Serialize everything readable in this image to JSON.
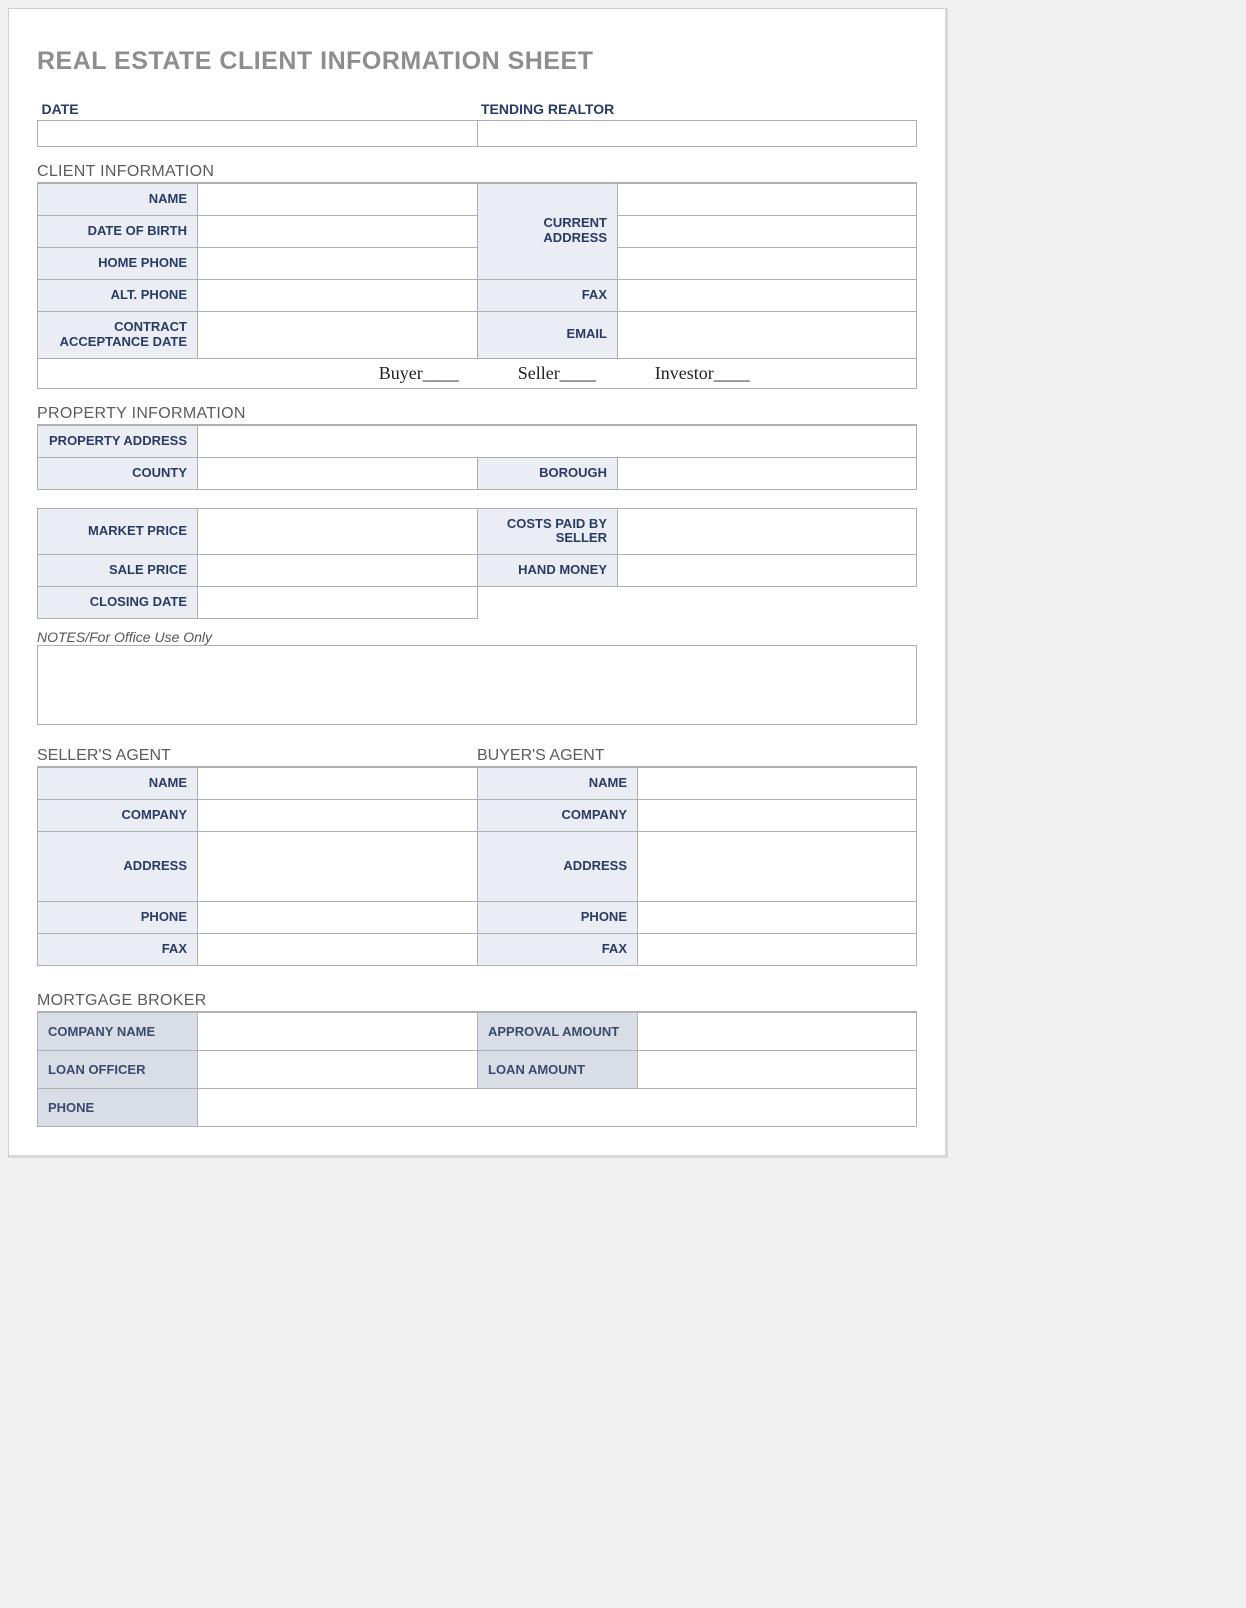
{
  "title": "REAL ESTATE CLIENT INFORMATION SHEET",
  "top": {
    "date_label": "DATE",
    "realtor_label": "TENDING REALTOR",
    "date_value": "",
    "realtor_value": ""
  },
  "client": {
    "heading": "CLIENT INFORMATION",
    "name_label": "NAME",
    "name_value": "",
    "dob_label": "DATE OF BIRTH",
    "dob_value": "",
    "home_phone_label": "HOME PHONE",
    "home_phone_value": "",
    "alt_phone_label": "ALT. PHONE",
    "alt_phone_value": "",
    "contract_date_label": "CONTRACT ACCEPTANCE DATE",
    "contract_date_value": "",
    "current_address_label": "CURRENT ADDRESS",
    "current_address_value": "",
    "fax_label": "FAX",
    "fax_value": "",
    "email_label": "EMAIL",
    "email_value": "",
    "role_buyer": "Buyer____",
    "role_seller": "Seller____",
    "role_investor": "Investor____"
  },
  "property": {
    "heading": "PROPERTY INFORMATION",
    "address_label": "PROPERTY ADDRESS",
    "address_value": "",
    "county_label": "COUNTY",
    "county_value": "",
    "borough_label": "BOROUGH",
    "borough_value": "",
    "market_price_label": "MARKET PRICE",
    "market_price_value": "",
    "costs_label": "COSTS PAID BY SELLER",
    "costs_value": "",
    "sale_price_label": "SALE PRICE",
    "sale_price_value": "",
    "hand_money_label": "HAND MONEY",
    "hand_money_value": "",
    "closing_date_label": "CLOSING DATE",
    "closing_date_value": ""
  },
  "notes": {
    "label": "NOTES/For Office Use Only",
    "value": ""
  },
  "seller_agent": {
    "heading": "SELLER'S AGENT",
    "name_label": "NAME",
    "name_value": "",
    "company_label": "COMPANY",
    "company_value": "",
    "address_label": "ADDRESS",
    "address_value": "",
    "phone_label": "PHONE",
    "phone_value": "",
    "fax_label": "FAX",
    "fax_value": ""
  },
  "buyer_agent": {
    "heading": "BUYER'S AGENT",
    "name_label": "NAME",
    "name_value": "",
    "company_label": "COMPANY",
    "company_value": "",
    "address_label": "ADDRESS",
    "address_value": "",
    "phone_label": "PHONE",
    "phone_value": "",
    "fax_label": "FAX",
    "fax_value": ""
  },
  "broker": {
    "heading": "MORTGAGE BROKER",
    "company_label": "COMPANY NAME",
    "company_value": "",
    "approval_label": "APPROVAL AMOUNT",
    "approval_value": "",
    "officer_label": "LOAN OFFICER",
    "officer_value": "",
    "loan_amount_label": "LOAN AMOUNT",
    "loan_amount_value": "",
    "phone_label": "PHONE",
    "phone_value": ""
  }
}
